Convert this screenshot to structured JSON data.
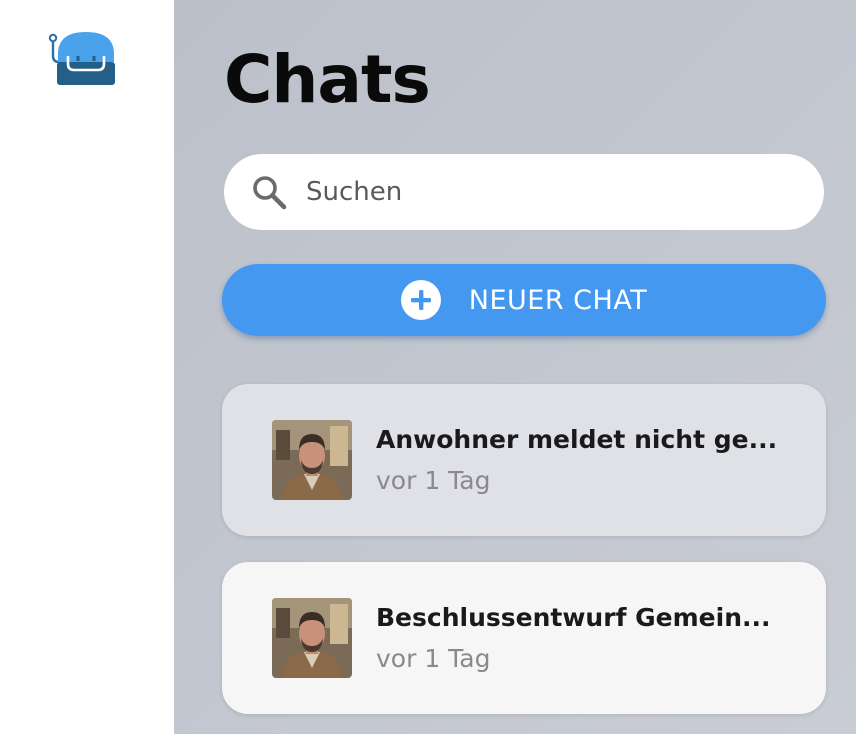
{
  "app": {
    "logo_icon": "robot-logo-icon"
  },
  "header": {
    "title": "Chats"
  },
  "search": {
    "placeholder": "Suchen",
    "icon": "search-icon"
  },
  "new_chat": {
    "label": "NEUER CHAT",
    "icon": "plus-circle-icon",
    "color": "#4498f0"
  },
  "chats": [
    {
      "title": "Anwohner meldet nicht ge...",
      "time": "vor 1 Tag"
    },
    {
      "title": "Beschlussentwurf Gemein...",
      "time": "vor 1 Tag"
    }
  ]
}
